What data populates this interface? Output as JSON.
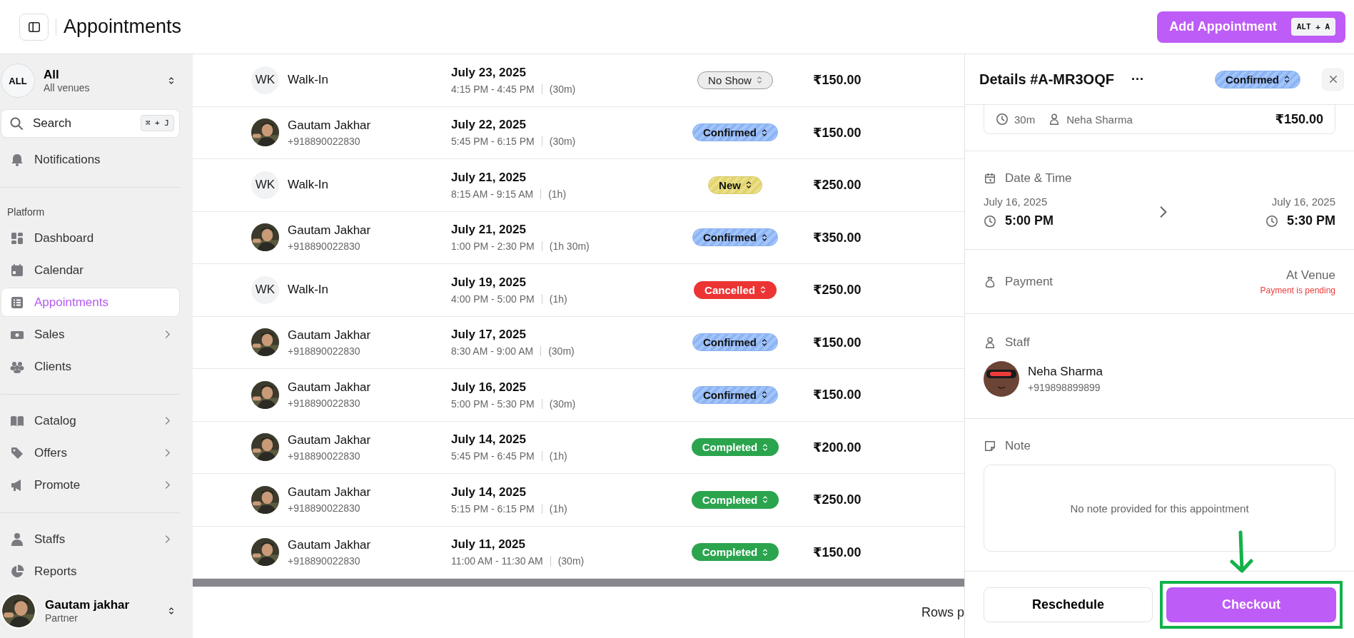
{
  "header": {
    "title": "Appointments",
    "add_button": {
      "label": "Add Appointment",
      "shortcut": "ALT + A"
    }
  },
  "sidebar": {
    "venue": {
      "badge": "ALL",
      "name": "All",
      "subtitle": "All venues"
    },
    "search": {
      "placeholder": "Search",
      "shortcut": "⌘ + J"
    },
    "notifications": "Notifications",
    "sections": [
      {
        "label": "Platform",
        "items": [
          {
            "label": "Dashboard",
            "selected": false,
            "expandable": false
          },
          {
            "label": "Calendar",
            "selected": false,
            "expandable": false
          },
          {
            "label": "Appointments",
            "selected": true,
            "expandable": false
          },
          {
            "label": "Sales",
            "selected": false,
            "expandable": true
          },
          {
            "label": "Clients",
            "selected": false,
            "expandable": false
          }
        ]
      },
      {
        "items": [
          {
            "label": "Catalog",
            "selected": false,
            "expandable": true
          },
          {
            "label": "Offers",
            "selected": false,
            "expandable": true
          },
          {
            "label": "Promote",
            "selected": false,
            "expandable": true
          }
        ]
      },
      {
        "items": [
          {
            "label": "Staffs",
            "selected": false,
            "expandable": true
          },
          {
            "label": "Reports",
            "selected": false,
            "expandable": false
          }
        ]
      }
    ],
    "user": {
      "name": "Gautam jakhar",
      "role": "Partner"
    }
  },
  "table": {
    "rows": [
      {
        "client": {
          "kind": "initials",
          "initials": "WK",
          "name": "Walk-In"
        },
        "date": "July 23, 2025",
        "time": "4:15 PM - 4:45 PM",
        "duration": "(30m)",
        "status": {
          "kind": "no_show",
          "label": "No Show"
        },
        "price": "₹150.00"
      },
      {
        "client": {
          "name": "Gautam Jakhar",
          "phone": "+918890022830"
        },
        "date": "July 22, 2025",
        "time": "5:45 PM - 6:15 PM",
        "duration": "(30m)",
        "status": {
          "kind": "confirmed",
          "label": "Confirmed"
        },
        "price": "₹150.00"
      },
      {
        "client": {
          "kind": "initials",
          "initials": "WK",
          "name": "Walk-In"
        },
        "date": "July 21, 2025",
        "time": "8:15 AM - 9:15 AM",
        "duration": "(1h)",
        "status": {
          "kind": "new",
          "label": "New"
        },
        "price": "₹250.00"
      },
      {
        "client": {
          "name": "Gautam Jakhar",
          "phone": "+918890022830"
        },
        "date": "July 21, 2025",
        "time": "1:00 PM - 2:30 PM",
        "duration": "(1h 30m)",
        "status": {
          "kind": "confirmed",
          "label": "Confirmed"
        },
        "price": "₹350.00"
      },
      {
        "client": {
          "kind": "initials",
          "initials": "WK",
          "name": "Walk-In"
        },
        "date": "July 19, 2025",
        "time": "4:00 PM - 5:00 PM",
        "duration": "(1h)",
        "status": {
          "kind": "cancelled",
          "label": "Cancelled"
        },
        "price": "₹250.00"
      },
      {
        "client": {
          "name": "Gautam Jakhar",
          "phone": "+918890022830"
        },
        "date": "July 17, 2025",
        "time": "8:30 AM - 9:00 AM",
        "duration": "(30m)",
        "status": {
          "kind": "confirmed",
          "label": "Confirmed"
        },
        "price": "₹150.00"
      },
      {
        "client": {
          "name": "Gautam Jakhar",
          "phone": "+918890022830"
        },
        "date": "July 16, 2025",
        "time": "5:00 PM - 5:30 PM",
        "duration": "(30m)",
        "status": {
          "kind": "confirmed",
          "label": "Confirmed"
        },
        "price": "₹150.00"
      },
      {
        "client": {
          "name": "Gautam Jakhar",
          "phone": "+918890022830"
        },
        "date": "July 14, 2025",
        "time": "5:45 PM - 6:45 PM",
        "duration": "(1h)",
        "status": {
          "kind": "completed",
          "label": "Completed"
        },
        "price": "₹200.00"
      },
      {
        "client": {
          "name": "Gautam Jakhar",
          "phone": "+918890022830"
        },
        "date": "July 14, 2025",
        "time": "5:15 PM - 6:15 PM",
        "duration": "(1h)",
        "status": {
          "kind": "completed",
          "label": "Completed"
        },
        "price": "₹250.00"
      },
      {
        "client": {
          "name": "Gautam Jakhar",
          "phone": "+918890022830"
        },
        "date": "July 11, 2025",
        "time": "11:00 AM - 11:30 AM",
        "duration": "(30m)",
        "status": {
          "kind": "completed",
          "label": "Completed"
        },
        "price": "₹150.00"
      }
    ],
    "footer": {
      "rows_label": "Rows p"
    }
  },
  "details": {
    "title": "Details #A-MR3OQF",
    "more": "···",
    "status": {
      "kind": "confirmed",
      "label": "Confirmed"
    },
    "service": {
      "duration": "30m",
      "staff": "Neha Sharma",
      "price": "₹150.00"
    },
    "date_time": {
      "heading": "Date & Time",
      "start_date": "July 16, 2025",
      "start_time": "5:00 PM",
      "end_date": "July 16, 2025",
      "end_time": "5:30 PM"
    },
    "payment": {
      "heading": "Payment",
      "method": "At Venue",
      "status": "Payment is pending"
    },
    "staff": {
      "heading": "Staff",
      "name": "Neha Sharma",
      "phone": "+919898899899"
    },
    "note": {
      "heading": "Note",
      "text": "No note provided for this appointment"
    },
    "buttons": {
      "secondary": "Reschedule",
      "primary": "Checkout",
      "highlighted": true
    }
  }
}
